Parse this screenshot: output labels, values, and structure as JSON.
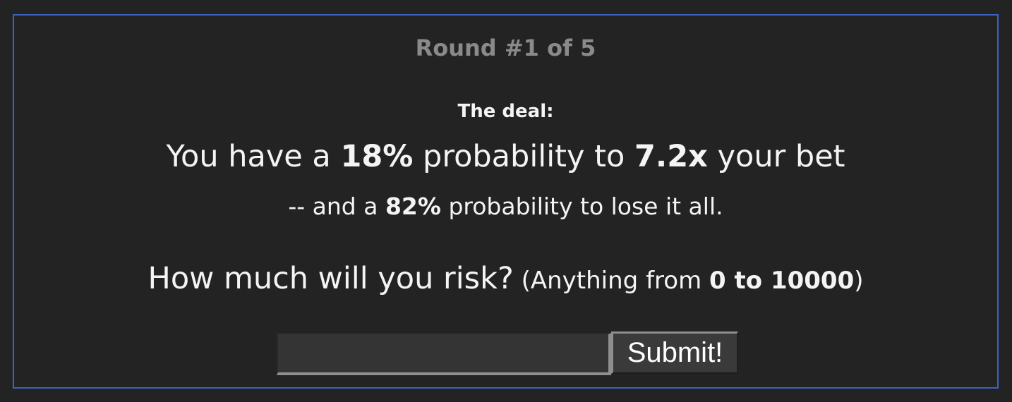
{
  "round": {
    "label": "Round #1 of 5"
  },
  "deal": {
    "label": "The deal:",
    "win_prefix": "You have a ",
    "win_probability": "18%",
    "win_mid": " probability to ",
    "win_multiplier": "7.2x",
    "win_suffix": " your bet",
    "lose_prefix": "-- and a ",
    "lose_probability": "82%",
    "lose_suffix": " probability to lose it all."
  },
  "risk": {
    "question": "How much will you risk?",
    "range_prefix": " (Anything from ",
    "range_value": "0 to 10000",
    "range_suffix": ")"
  },
  "form": {
    "amount_value": "",
    "submit_label": "Submit!"
  },
  "colors": {
    "background": "#232323",
    "panel_border": "#3a63c4",
    "round_text": "#8a8a8a",
    "text": "#f4f4f4"
  }
}
